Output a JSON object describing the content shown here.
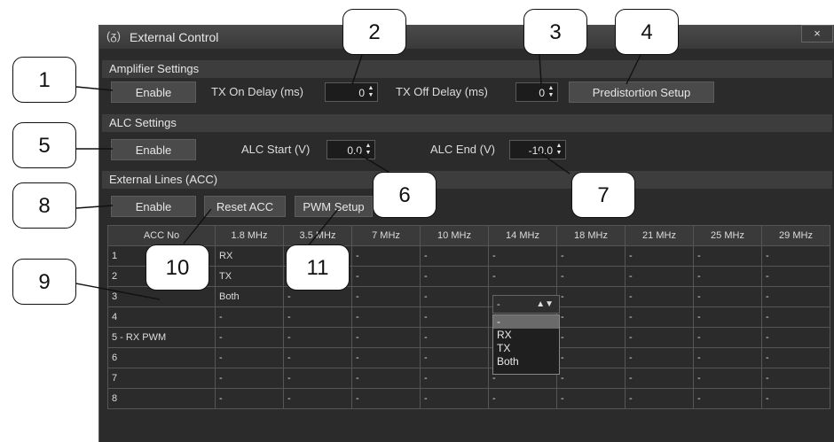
{
  "window": {
    "title": "External Control",
    "close_label": "×"
  },
  "amplifier": {
    "header": "Amplifier Settings",
    "enable_label": "Enable",
    "tx_on_label": "TX On Delay (ms)",
    "tx_on_value": "0",
    "tx_off_label": "TX Off Delay (ms)",
    "tx_off_value": "0",
    "predistortion_label": "Predistortion Setup"
  },
  "alc": {
    "header": "ALC Settings",
    "enable_label": "Enable",
    "start_label": "ALC Start (V)",
    "start_value": "0.0",
    "end_label": "ALC End (V)",
    "end_value": "-10.0"
  },
  "lines": {
    "header": "External Lines (ACC)",
    "enable_label": "Enable",
    "reset_label": "Reset ACC",
    "pwm_label": "PWM Setup"
  },
  "table": {
    "columns": [
      "ACC No",
      "1.8 MHz",
      "3.5 MHz",
      "7 MHz",
      "10 MHz",
      "14 MHz",
      "18 MHz",
      "21 MHz",
      "25 MHz",
      "29 MHz"
    ],
    "rows": [
      [
        "1",
        "RX",
        "-",
        "-",
        "-",
        "-",
        "-",
        "-",
        "-",
        "-"
      ],
      [
        "2",
        "TX",
        "-",
        "-",
        "-",
        "-",
        "-",
        "-",
        "-",
        "-"
      ],
      [
        "3",
        "Both",
        "-",
        "-",
        "-",
        "-",
        "-",
        "-",
        "-",
        "-"
      ],
      [
        "4",
        "-",
        "-",
        "-",
        "-",
        "",
        "-",
        "-",
        "-",
        "-"
      ],
      [
        "5 - RX PWM",
        "-",
        "-",
        "-",
        "-",
        "",
        "-",
        "-",
        "-",
        "-"
      ],
      [
        "6",
        "-",
        "-",
        "-",
        "-",
        "-",
        "-",
        "-",
        "-",
        "-"
      ],
      [
        "7",
        "-",
        "-",
        "-",
        "-",
        "-",
        "-",
        "-",
        "-",
        "-"
      ],
      [
        "8",
        "-",
        "-",
        "-",
        "-",
        "-",
        "-",
        "-",
        "-",
        "-"
      ]
    ]
  },
  "dropdown": {
    "selected": "-",
    "options": [
      "-",
      "RX",
      "TX",
      "Both"
    ]
  },
  "callouts": [
    "1",
    "2",
    "3",
    "4",
    "5",
    "6",
    "7",
    "8",
    "9",
    "10",
    "11"
  ],
  "icons": {
    "title_icon": "remote-control-icon",
    "spin_arrows": "up-down-arrows-icon"
  }
}
